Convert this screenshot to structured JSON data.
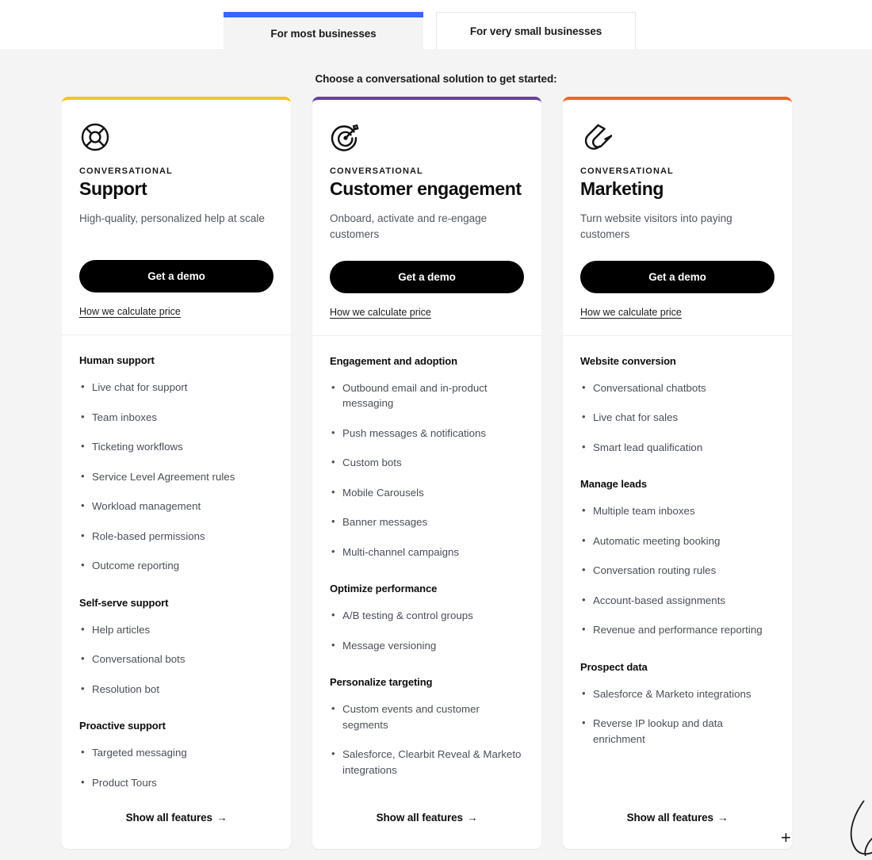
{
  "tabs": [
    {
      "label": "For most businesses",
      "active": true,
      "accent": "#3767ff"
    },
    {
      "label": "For very small businesses",
      "active": false
    }
  ],
  "subheading": "Choose a conversational solution to get started:",
  "common": {
    "cta_label": "Get a demo",
    "price_link_label": "How we calculate price",
    "show_all_label": "Show all features",
    "show_all_arrow": "→",
    "eyebrow": "CONVERSATIONAL"
  },
  "decorations": {
    "plus": "+"
  },
  "cards": [
    {
      "accent": "#f5c518",
      "icon": "lifebuoy-icon",
      "eyebrow": "CONVERSATIONAL",
      "title": "Support",
      "description": "High-quality, personalized help at scale",
      "cta_label": "Get a demo",
      "price_link_label": "How we calculate price",
      "groups": [
        {
          "title": "Human support",
          "items": [
            "Live chat for support",
            "Team inboxes",
            "Ticketing workflows",
            "Service Level Agreement rules",
            "Workload management",
            "Role-based permissions",
            "Outcome reporting"
          ]
        },
        {
          "title": "Self-serve support",
          "items": [
            "Help articles",
            "Conversational bots",
            "Resolution bot"
          ]
        },
        {
          "title": "Proactive support",
          "items": [
            "Targeted messaging",
            "Product Tours"
          ]
        }
      ],
      "show_all_label": "Show all features"
    },
    {
      "accent": "#6a3fa0",
      "icon": "target-dart-icon",
      "eyebrow": "CONVERSATIONAL",
      "title": "Customer engagement",
      "description": "Onboard, activate and re-engage customers",
      "cta_label": "Get a demo",
      "price_link_label": "How we calculate price",
      "groups": [
        {
          "title": "Engagement and adoption",
          "items": [
            "Outbound email and in-product messaging",
            "Push messages & notifications",
            "Custom bots",
            "Mobile Carousels",
            "Banner messages",
            "Multi-channel campaigns"
          ]
        },
        {
          "title": "Optimize performance",
          "items": [
            "A/B testing & control groups",
            "Message versioning"
          ]
        },
        {
          "title": "Personalize targeting",
          "items": [
            "Custom events and customer segments",
            "Salesforce, Clearbit Reveal & Marketo integrations"
          ]
        }
      ],
      "show_all_label": "Show all features"
    },
    {
      "accent": "#f26422",
      "icon": "magnet-icon",
      "eyebrow": "CONVERSATIONAL",
      "title": "Marketing",
      "description": "Turn website visitors into paying customers",
      "cta_label": "Get a demo",
      "price_link_label": "How we calculate price",
      "groups": [
        {
          "title": "Website conversion",
          "items": [
            "Conversational chatbots",
            "Live chat for sales",
            "Smart lead qualification"
          ]
        },
        {
          "title": "Manage leads",
          "items": [
            "Multiple team inboxes",
            "Automatic meeting booking",
            "Conversation routing rules",
            "Account-based assignments",
            "Revenue and performance reporting"
          ]
        },
        {
          "title": "Prospect data",
          "items": [
            "Salesforce & Marketo integrations",
            "Reverse IP lookup and data enrichment"
          ]
        }
      ],
      "show_all_label": "Show all features"
    }
  ]
}
